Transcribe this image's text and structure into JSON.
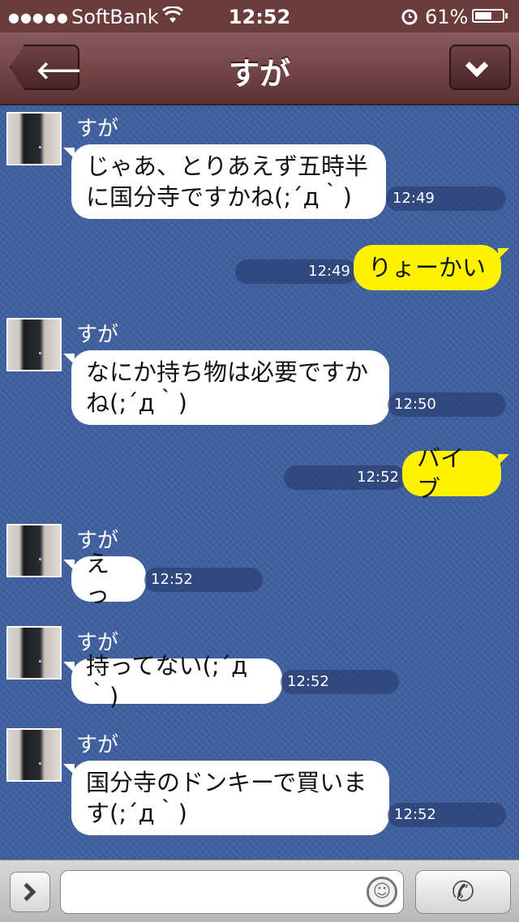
{
  "status_bar": {
    "signal": "●●●●●",
    "carrier": "SoftBank",
    "time": "12:52",
    "battery": "61%",
    "battery_level": 0.61,
    "icons": [
      "wifi-icon",
      "alarm-icon",
      "battery-icon"
    ]
  },
  "header": {
    "title": "すが",
    "back_icon": "back-arrow-icon",
    "menu_icon": "chevron-down-icon"
  },
  "chat": {
    "messages": [
      {
        "direction": "incoming",
        "sender": "すが",
        "text": "じゃあ、とりあえず五時半\nに国分寺ですかね(;´д｀)",
        "time": "12:49"
      },
      {
        "direction": "outgoing",
        "text": "りょーかい",
        "time": "12:49"
      },
      {
        "direction": "incoming",
        "sender": "すが",
        "text": "なにか持ち物は必要ですか\nね(;´д｀)",
        "time": "12:50"
      },
      {
        "direction": "outgoing",
        "text": "バイブ",
        "time": "12:52"
      },
      {
        "direction": "incoming",
        "sender": "すが",
        "text": "えっ",
        "time": "12:52"
      },
      {
        "direction": "incoming",
        "sender": "すが",
        "text": "持ってない(;´д｀)",
        "time": "12:52"
      },
      {
        "direction": "incoming",
        "sender": "すが",
        "text": "国分寺のドンキーで買いま\nす(;´д｀)",
        "time": "12:52"
      }
    ]
  },
  "input_bar": {
    "placeholder": "",
    "smiley": "☺",
    "call": "✆",
    "icons": [
      "chevron-right-icon",
      "smiley-icon",
      "phone-icon"
    ],
    "colors": {
      "incoming_bubble": "#ffffff",
      "outgoing_bubble": "#fff200",
      "header": "#6e4244",
      "chat_bg": "#3f609f"
    }
  }
}
